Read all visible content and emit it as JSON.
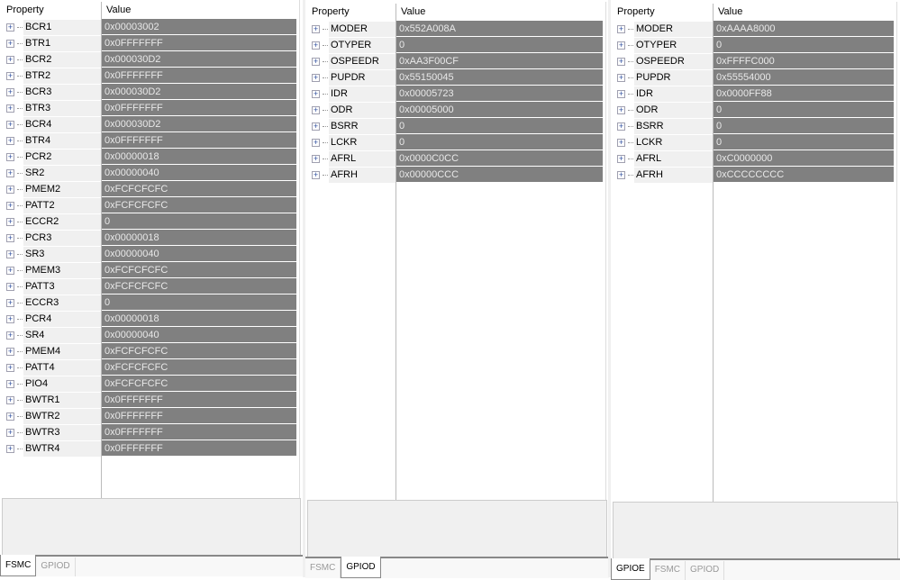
{
  "headers": {
    "property": "Property",
    "value": "Value"
  },
  "panels": [
    {
      "id": "fsmc",
      "tabs": [
        "FSMC",
        "GPIOD"
      ],
      "active_tab": 0,
      "rows": [
        [
          "BCR1",
          "0x00003002"
        ],
        [
          "BTR1",
          "0x0FFFFFFF"
        ],
        [
          "BCR2",
          "0x000030D2"
        ],
        [
          "BTR2",
          "0x0FFFFFFF"
        ],
        [
          "BCR3",
          "0x000030D2"
        ],
        [
          "BTR3",
          "0x0FFFFFFF"
        ],
        [
          "BCR4",
          "0x000030D2"
        ],
        [
          "BTR4",
          "0x0FFFFFFF"
        ],
        [
          "PCR2",
          "0x00000018"
        ],
        [
          "SR2",
          "0x00000040"
        ],
        [
          "PMEM2",
          "0xFCFCFCFC"
        ],
        [
          "PATT2",
          "0xFCFCFCFC"
        ],
        [
          "ECCR2",
          "0"
        ],
        [
          "PCR3",
          "0x00000018"
        ],
        [
          "SR3",
          "0x00000040"
        ],
        [
          "PMEM3",
          "0xFCFCFCFC"
        ],
        [
          "PATT3",
          "0xFCFCFCFC"
        ],
        [
          "ECCR3",
          "0"
        ],
        [
          "PCR4",
          "0x00000018"
        ],
        [
          "SR4",
          "0x00000040"
        ],
        [
          "PMEM4",
          "0xFCFCFCFC"
        ],
        [
          "PATT4",
          "0xFCFCFCFC"
        ],
        [
          "PIO4",
          "0xFCFCFCFC"
        ],
        [
          "BWTR1",
          "0x0FFFFFFF"
        ],
        [
          "BWTR2",
          "0x0FFFFFFF"
        ],
        [
          "BWTR3",
          "0x0FFFFFFF"
        ],
        [
          "BWTR4",
          "0x0FFFFFFF"
        ]
      ]
    },
    {
      "id": "gpiod",
      "tabs": [
        "FSMC",
        "GPIOD"
      ],
      "active_tab": 1,
      "rows": [
        [
          "MODER",
          "0x552A008A"
        ],
        [
          "OTYPER",
          "0"
        ],
        [
          "OSPEEDR",
          "0xAA3F00CF"
        ],
        [
          "PUPDR",
          "0x55150045"
        ],
        [
          "IDR",
          "0x00005723"
        ],
        [
          "ODR",
          "0x00005000"
        ],
        [
          "BSRR",
          "0"
        ],
        [
          "LCKR",
          "0"
        ],
        [
          "AFRL",
          "0x0000C0CC"
        ],
        [
          "AFRH",
          "0x00000CCC"
        ]
      ]
    },
    {
      "id": "gpioe",
      "tabs": [
        "GPIOE",
        "FSMC",
        "GPIOD"
      ],
      "active_tab": 0,
      "rows": [
        [
          "MODER",
          "0xAAAA8000"
        ],
        [
          "OTYPER",
          "0"
        ],
        [
          "OSPEEDR",
          "0xFFFFC000"
        ],
        [
          "PUPDR",
          "0x55554000"
        ],
        [
          "IDR",
          "0x0000FF88"
        ],
        [
          "ODR",
          "0"
        ],
        [
          "BSRR",
          "0"
        ],
        [
          "LCKR",
          "0"
        ],
        [
          "AFRL",
          "0xC0000000"
        ],
        [
          "AFRH",
          "0xCCCCCCCC"
        ]
      ]
    }
  ]
}
